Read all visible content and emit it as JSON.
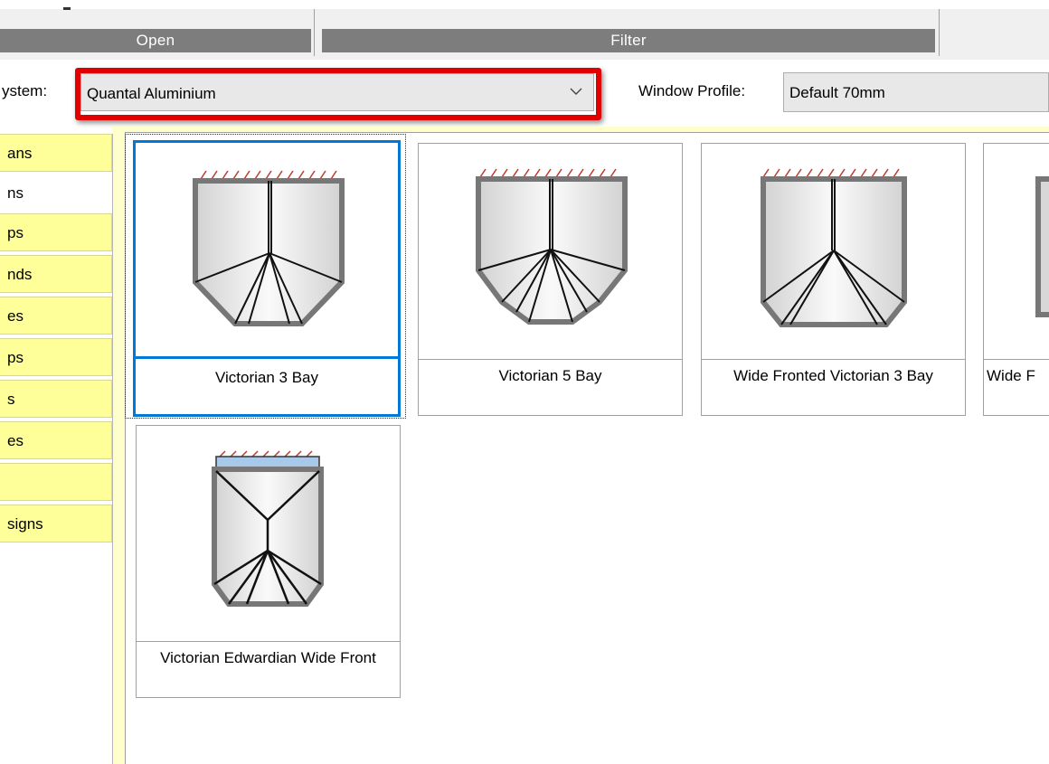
{
  "ribbon": {
    "groups": [
      {
        "label": "Open"
      },
      {
        "label": "Filter"
      }
    ]
  },
  "fields": {
    "system_label": "ystem:",
    "system_value": "Quantal Aluminium",
    "window_profile_label": "Window Profile:",
    "window_profile_value": "Default 70mm"
  },
  "categories": [
    {
      "label": "ans"
    },
    {
      "label": "ns"
    },
    {
      "label": "ps"
    },
    {
      "label": "nds"
    },
    {
      "label": "es"
    },
    {
      "label": "ps"
    },
    {
      "label": "s"
    },
    {
      "label": "es"
    },
    {
      "label": ""
    },
    {
      "label": "signs"
    }
  ],
  "designs": [
    {
      "caption": "Victorian 3 Bay",
      "icon": "victorian-3-bay-icon",
      "selected": true
    },
    {
      "caption": "Victorian 5 Bay",
      "icon": "victorian-5-bay-icon",
      "selected": false
    },
    {
      "caption": "Wide Fronted Victorian 3 Bay",
      "icon": "wide-fronted-victorian-3-bay-icon",
      "selected": false
    },
    {
      "caption": "Wide F",
      "icon": "wide-fronted-partial-icon",
      "selected": false
    },
    {
      "caption": "Victorian Edwardian Wide Front",
      "icon": "victorian-edwardian-wide-front-icon",
      "selected": false
    }
  ],
  "colors": {
    "tab_background": "#ffff99",
    "highlight_border": "#e00000",
    "selection_border": "#0078d7",
    "ribbon_group": "#7d7d7d"
  }
}
